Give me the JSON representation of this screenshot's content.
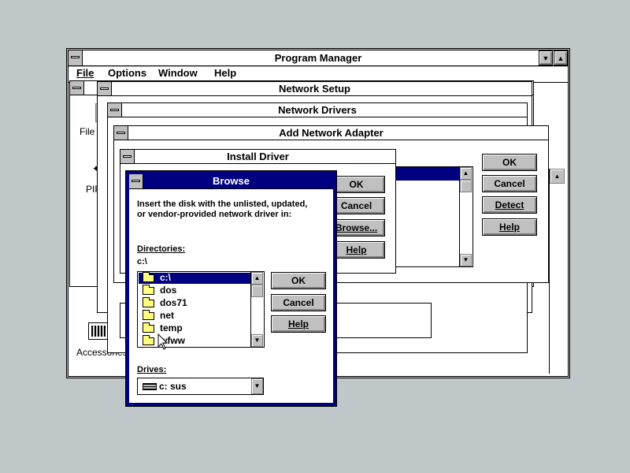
{
  "program_manager": {
    "title": "Program Manager",
    "menu": [
      "File",
      "Options",
      "Window",
      "Help"
    ],
    "icon_labels": [
      "File M",
      "PIF",
      "Accessories"
    ]
  },
  "network_setup": {
    "title": "Network Setup"
  },
  "network_drivers": {
    "title": "Network Drivers"
  },
  "add_network_adapter": {
    "title": "Add Network Adapter",
    "buttons": [
      "OK",
      "Cancel",
      "Detect",
      "Help"
    ]
  },
  "install_driver": {
    "title": "Install Driver",
    "buttons": [
      "OK",
      "Cancel",
      "Browse...",
      "Help"
    ]
  },
  "browse": {
    "title": "Browse",
    "instruction_line1": "Insert the disk with the unlisted, updated,",
    "instruction_line2": "or vendor-provided network driver in:",
    "directories_label": "Directories:",
    "current_path": "c:\\",
    "directories": [
      "c:\\",
      "dos",
      "dos71",
      "net",
      "temp",
      "wfww"
    ],
    "selected_directory": "c:\\",
    "drives_label": "Drives:",
    "drive_value": "c: sus",
    "buttons": [
      "OK",
      "Cancel",
      "Help"
    ]
  }
}
